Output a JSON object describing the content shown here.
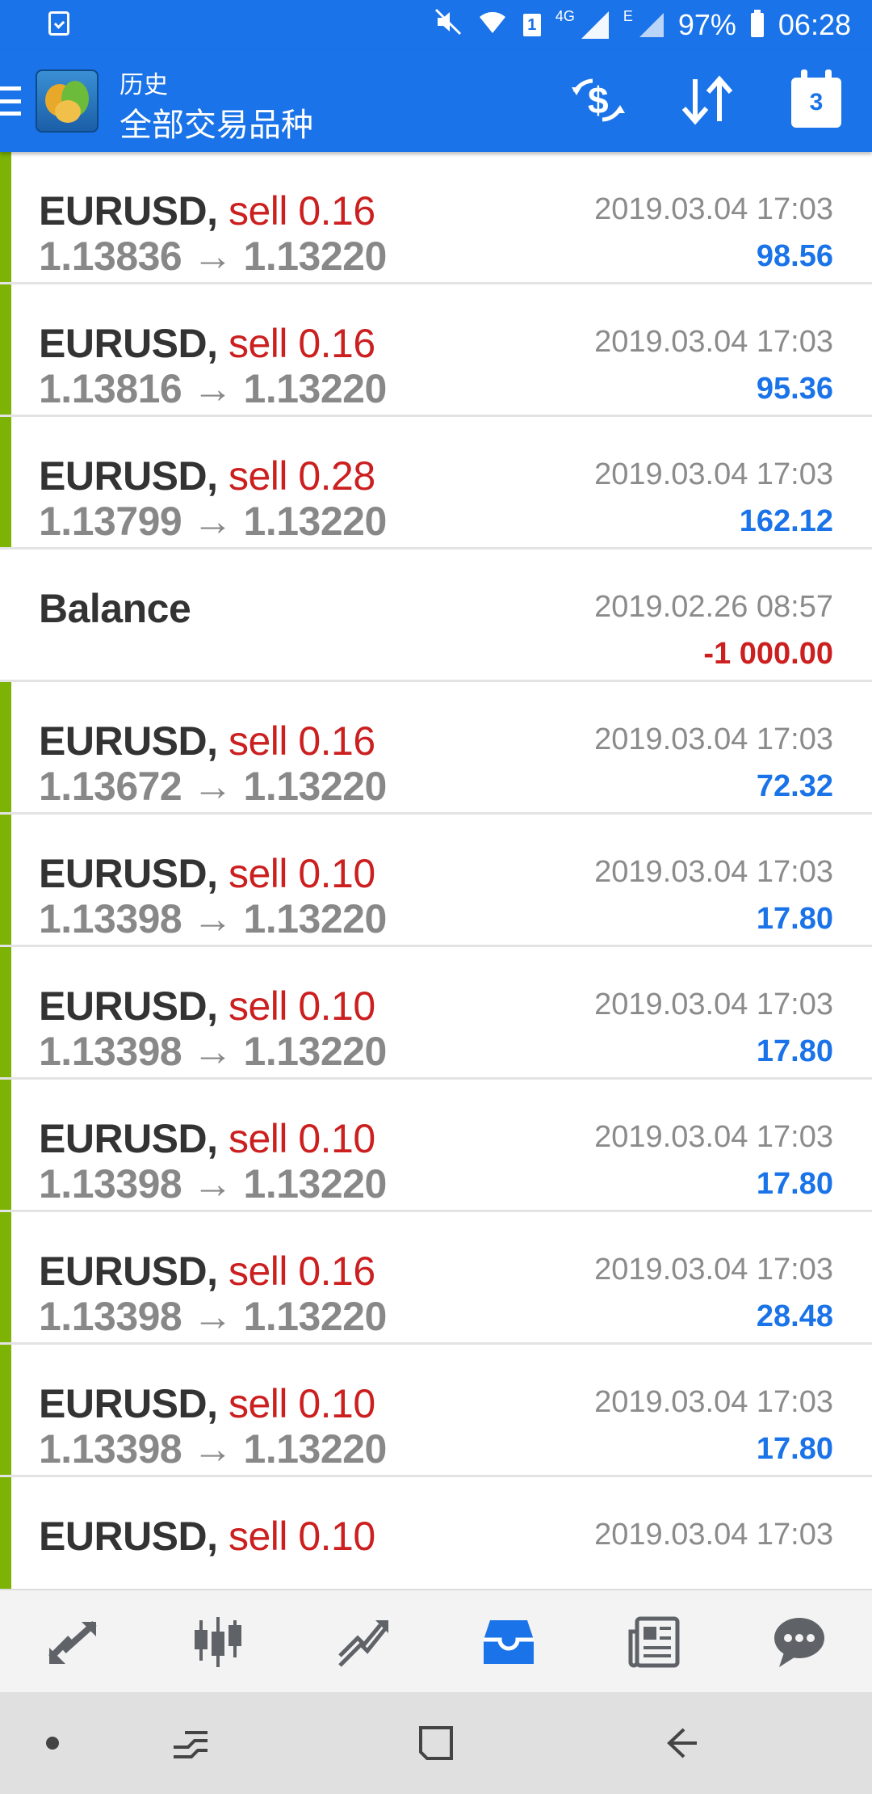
{
  "status_bar": {
    "network_small": "4G",
    "network_e": "E",
    "sim": "1",
    "battery": "97%",
    "time": "06:28"
  },
  "header": {
    "subtitle": "历史",
    "title": "全部交易品种",
    "calendar_day": "3",
    "icons": [
      "menu-icon",
      "app-logo",
      "currency-exchange-icon",
      "sort-icon",
      "calendar-icon"
    ]
  },
  "trades": [
    {
      "symbol": "EURUSD,",
      "action": "sell 0.16",
      "prices": "1.13836 → 1.13220",
      "time": "2019.03.04 17:03",
      "profit": "98.56",
      "type": "trade"
    },
    {
      "symbol": "EURUSD,",
      "action": "sell 0.16",
      "prices": "1.13816 → 1.13220",
      "time": "2019.03.04 17:03",
      "profit": "95.36",
      "type": "trade"
    },
    {
      "symbol": "EURUSD,",
      "action": "sell 0.28",
      "prices": "1.13799 → 1.13220",
      "time": "2019.03.04 17:03",
      "profit": "162.12",
      "type": "trade"
    },
    {
      "symbol": "Balance",
      "action": "",
      "prices": "",
      "time": "2019.02.26 08:57",
      "profit": "-1 000.00",
      "type": "balance"
    },
    {
      "symbol": "EURUSD,",
      "action": "sell 0.16",
      "prices": "1.13672 → 1.13220",
      "time": "2019.03.04 17:03",
      "profit": "72.32",
      "type": "trade"
    },
    {
      "symbol": "EURUSD,",
      "action": "sell 0.10",
      "prices": "1.13398 → 1.13220",
      "time": "2019.03.04 17:03",
      "profit": "17.80",
      "type": "trade"
    },
    {
      "symbol": "EURUSD,",
      "action": "sell 0.10",
      "prices": "1.13398 → 1.13220",
      "time": "2019.03.04 17:03",
      "profit": "17.80",
      "type": "trade"
    },
    {
      "symbol": "EURUSD,",
      "action": "sell 0.10",
      "prices": "1.13398 → 1.13220",
      "time": "2019.03.04 17:03",
      "profit": "17.80",
      "type": "trade"
    },
    {
      "symbol": "EURUSD,",
      "action": "sell 0.16",
      "prices": "1.13398 → 1.13220",
      "time": "2019.03.04 17:03",
      "profit": "28.48",
      "type": "trade"
    },
    {
      "symbol": "EURUSD,",
      "action": "sell 0.10",
      "prices": "1.13398 → 1.13220",
      "time": "2019.03.04 17:03",
      "profit": "17.80",
      "type": "trade"
    },
    {
      "symbol": "EURUSD,",
      "action": "sell 0.10",
      "prices": "",
      "time": "2019.03.04 17:03",
      "profit": "",
      "type": "trade"
    }
  ],
  "colors": {
    "accent_blue": "#1a73e8",
    "sell_red": "#cc1f1f",
    "trade_bar_green": "#7cb305",
    "profit_blue": "#1a73e8"
  },
  "bottom_nav": {
    "items": [
      "quotes-icon",
      "chart-candles-icon",
      "trade-icon",
      "history-inbox-icon",
      "news-icon",
      "chat-icon"
    ],
    "active": "history-inbox-icon"
  },
  "system_nav": {
    "items": [
      "dot-icon",
      "recent-apps-icon",
      "home-icon",
      "back-icon"
    ]
  }
}
